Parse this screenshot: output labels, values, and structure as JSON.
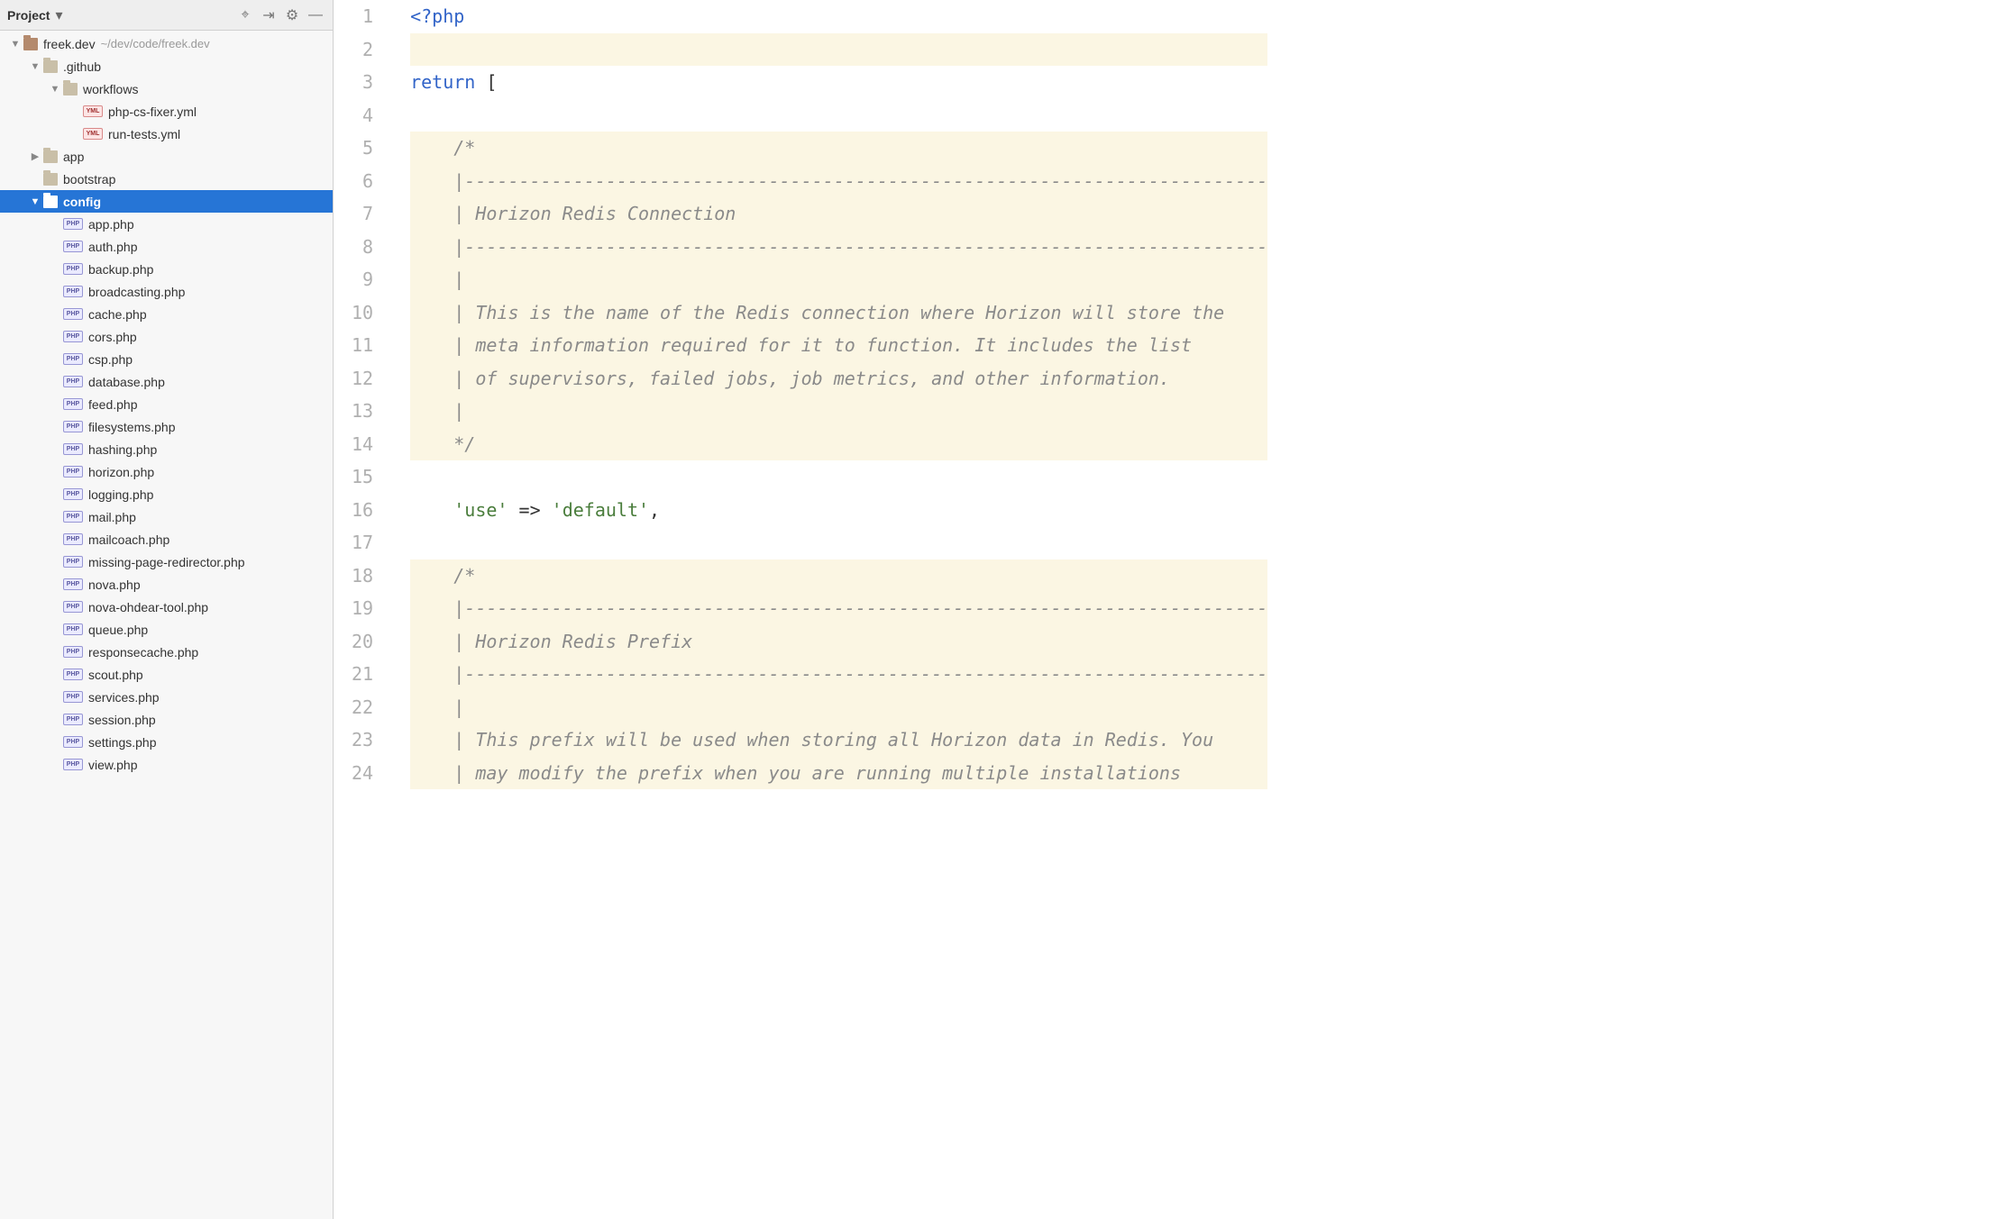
{
  "sidebar": {
    "title": "Project",
    "project_name": "freek.dev",
    "project_path": "~/dev/code/freek.dev",
    "tree": [
      {
        "indent": 1,
        "arrow": "down",
        "icon": "folder-root",
        "label": "freek.dev",
        "dim": "~/dev/code/freek.dev",
        "selected": false
      },
      {
        "indent": 2,
        "arrow": "down",
        "icon": "folder",
        "label": ".github"
      },
      {
        "indent": 3,
        "arrow": "down",
        "icon": "folder",
        "label": "workflows"
      },
      {
        "indent": 4,
        "arrow": "none",
        "icon": "yml",
        "label": "php-cs-fixer.yml"
      },
      {
        "indent": 4,
        "arrow": "none",
        "icon": "yml",
        "label": "run-tests.yml"
      },
      {
        "indent": 2,
        "arrow": "right",
        "icon": "folder",
        "label": "app"
      },
      {
        "indent": 2,
        "arrow": "none",
        "icon": "folder",
        "label": "bootstrap"
      },
      {
        "indent": 2,
        "arrow": "down",
        "icon": "folder",
        "label": "config",
        "selected": true
      },
      {
        "indent": 3,
        "arrow": "none",
        "icon": "php",
        "label": "app.php"
      },
      {
        "indent": 3,
        "arrow": "none",
        "icon": "php",
        "label": "auth.php"
      },
      {
        "indent": 3,
        "arrow": "none",
        "icon": "php",
        "label": "backup.php"
      },
      {
        "indent": 3,
        "arrow": "none",
        "icon": "php",
        "label": "broadcasting.php"
      },
      {
        "indent": 3,
        "arrow": "none",
        "icon": "php",
        "label": "cache.php"
      },
      {
        "indent": 3,
        "arrow": "none",
        "icon": "php",
        "label": "cors.php"
      },
      {
        "indent": 3,
        "arrow": "none",
        "icon": "php",
        "label": "csp.php"
      },
      {
        "indent": 3,
        "arrow": "none",
        "icon": "php",
        "label": "database.php"
      },
      {
        "indent": 3,
        "arrow": "none",
        "icon": "php",
        "label": "feed.php"
      },
      {
        "indent": 3,
        "arrow": "none",
        "icon": "php",
        "label": "filesystems.php"
      },
      {
        "indent": 3,
        "arrow": "none",
        "icon": "php",
        "label": "hashing.php"
      },
      {
        "indent": 3,
        "arrow": "none",
        "icon": "php",
        "label": "horizon.php"
      },
      {
        "indent": 3,
        "arrow": "none",
        "icon": "php",
        "label": "logging.php"
      },
      {
        "indent": 3,
        "arrow": "none",
        "icon": "php",
        "label": "mail.php"
      },
      {
        "indent": 3,
        "arrow": "none",
        "icon": "php",
        "label": "mailcoach.php"
      },
      {
        "indent": 3,
        "arrow": "none",
        "icon": "php",
        "label": "missing-page-redirector.php"
      },
      {
        "indent": 3,
        "arrow": "none",
        "icon": "php",
        "label": "nova.php"
      },
      {
        "indent": 3,
        "arrow": "none",
        "icon": "php",
        "label": "nova-ohdear-tool.php"
      },
      {
        "indent": 3,
        "arrow": "none",
        "icon": "php",
        "label": "queue.php"
      },
      {
        "indent": 3,
        "arrow": "none",
        "icon": "php",
        "label": "responsecache.php"
      },
      {
        "indent": 3,
        "arrow": "none",
        "icon": "php",
        "label": "scout.php"
      },
      {
        "indent": 3,
        "arrow": "none",
        "icon": "php",
        "label": "services.php"
      },
      {
        "indent": 3,
        "arrow": "none",
        "icon": "php",
        "label": "session.php"
      },
      {
        "indent": 3,
        "arrow": "none",
        "icon": "php",
        "label": "settings.php"
      },
      {
        "indent": 3,
        "arrow": "none",
        "icon": "php",
        "label": "view.php"
      }
    ]
  },
  "editor": {
    "lines": [
      {
        "n": 1,
        "hl": false,
        "tokens": [
          [
            "tag",
            "<?php"
          ]
        ]
      },
      {
        "n": 2,
        "hl": true,
        "tokens": []
      },
      {
        "n": 3,
        "hl": false,
        "tokens": [
          [
            "keyword",
            "return"
          ],
          [
            "punct",
            " ["
          ]
        ]
      },
      {
        "n": 4,
        "hl": false,
        "tokens": []
      },
      {
        "n": 5,
        "hl": true,
        "tokens": [
          [
            "comment",
            "    /*"
          ]
        ]
      },
      {
        "n": 6,
        "hl": true,
        "tokens": [
          [
            "comment",
            "    |--------------------------------------------------------------------------"
          ]
        ]
      },
      {
        "n": 7,
        "hl": true,
        "tokens": [
          [
            "comment",
            "    | Horizon Redis Connection"
          ]
        ]
      },
      {
        "n": 8,
        "hl": true,
        "tokens": [
          [
            "comment",
            "    |--------------------------------------------------------------------------"
          ]
        ]
      },
      {
        "n": 9,
        "hl": true,
        "tokens": [
          [
            "comment",
            "    |"
          ]
        ]
      },
      {
        "n": 10,
        "hl": true,
        "tokens": [
          [
            "comment",
            "    | This is the name of the Redis connection where Horizon will store the"
          ]
        ]
      },
      {
        "n": 11,
        "hl": true,
        "tokens": [
          [
            "comment",
            "    | meta information required for it to function. It includes the list"
          ]
        ]
      },
      {
        "n": 12,
        "hl": true,
        "tokens": [
          [
            "comment",
            "    | of supervisors, failed jobs, job metrics, and other information."
          ]
        ]
      },
      {
        "n": 13,
        "hl": true,
        "tokens": [
          [
            "comment",
            "    |"
          ]
        ]
      },
      {
        "n": 14,
        "hl": true,
        "tokens": [
          [
            "comment",
            "    */"
          ]
        ]
      },
      {
        "n": 15,
        "hl": false,
        "tokens": []
      },
      {
        "n": 16,
        "hl": false,
        "tokens": [
          [
            "punct",
            "    "
          ],
          [
            "string",
            "'use'"
          ],
          [
            "punct",
            " => "
          ],
          [
            "string",
            "'default'"
          ],
          [
            "punct",
            ","
          ]
        ]
      },
      {
        "n": 17,
        "hl": false,
        "tokens": []
      },
      {
        "n": 18,
        "hl": true,
        "tokens": [
          [
            "comment",
            "    /*"
          ]
        ]
      },
      {
        "n": 19,
        "hl": true,
        "tokens": [
          [
            "comment",
            "    |--------------------------------------------------------------------------"
          ]
        ]
      },
      {
        "n": 20,
        "hl": true,
        "tokens": [
          [
            "comment",
            "    | Horizon Redis Prefix"
          ]
        ]
      },
      {
        "n": 21,
        "hl": true,
        "tokens": [
          [
            "comment",
            "    |--------------------------------------------------------------------------"
          ]
        ]
      },
      {
        "n": 22,
        "hl": true,
        "tokens": [
          [
            "comment",
            "    |"
          ]
        ]
      },
      {
        "n": 23,
        "hl": true,
        "tokens": [
          [
            "comment",
            "    | This prefix will be used when storing all Horizon data in Redis. You"
          ]
        ]
      },
      {
        "n": 24,
        "hl": true,
        "tokens": [
          [
            "comment",
            "    | may modify the prefix when you are running multiple installations"
          ]
        ]
      }
    ]
  }
}
